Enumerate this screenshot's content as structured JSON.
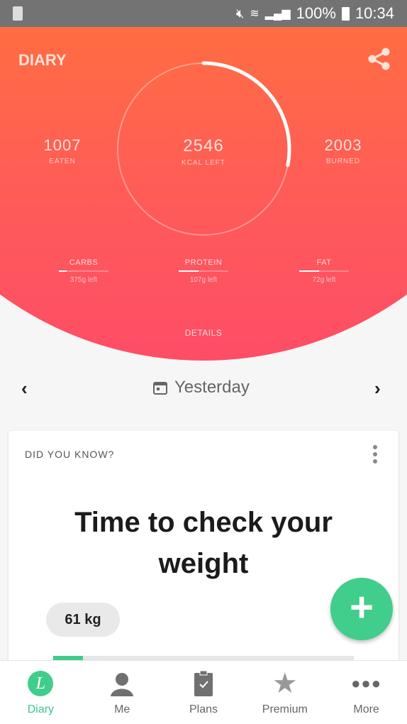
{
  "status_bar": {
    "battery": "100%",
    "time": "10:34"
  },
  "header": {
    "title": "DIARY",
    "share_icon": "share-icon"
  },
  "summary": {
    "eaten": {
      "value": "1007",
      "label": "EATEN"
    },
    "kcal_left": {
      "value": "2546",
      "label": "KCAL LEFT"
    },
    "burned": {
      "value": "2003",
      "label": "BURNED"
    },
    "ring_progress": 0.28
  },
  "macros": [
    {
      "label": "CARBS",
      "left": "375g left",
      "progress": 0.15
    },
    {
      "label": "PROTEIN",
      "left": "107g left",
      "progress": 0.4
    },
    {
      "label": "FAT",
      "left": "72g left",
      "progress": 0.4
    }
  ],
  "details_label": "DETAILS",
  "date_nav": {
    "label": "Yesterday"
  },
  "card": {
    "header": "DID YOU KNOW?",
    "title": "Time to check your weight",
    "weight": "61 kg",
    "progress": 0.1
  },
  "colors": {
    "accent": "#41cd8b",
    "hero_top": "#ff6d42",
    "hero_bottom": "#fe4d66"
  },
  "nav": [
    {
      "label": "Diary"
    },
    {
      "label": "Me"
    },
    {
      "label": "Plans"
    },
    {
      "label": "Premium"
    },
    {
      "label": "More"
    }
  ]
}
